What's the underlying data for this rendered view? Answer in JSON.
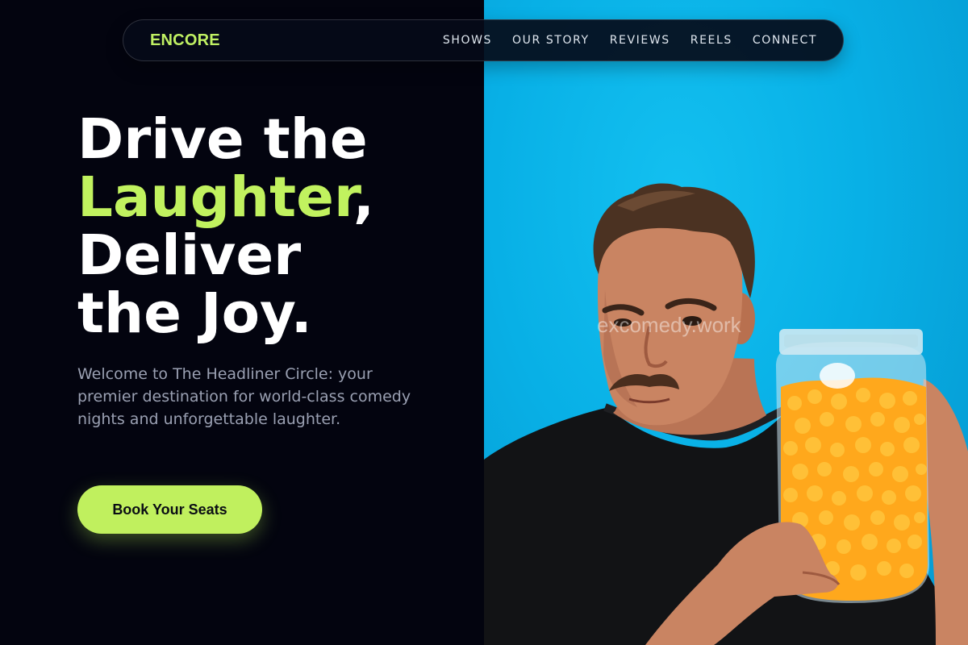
{
  "brand": {
    "name": "ENCORE",
    "accent_color": "#c0f063"
  },
  "nav": {
    "links": [
      {
        "label": "SHOWS"
      },
      {
        "label": "OUR STORY"
      },
      {
        "label": "REVIEWS"
      },
      {
        "label": "REELS"
      },
      {
        "label": "CONNECT"
      }
    ]
  },
  "hero": {
    "title_line1": "Drive the",
    "title_accent": "Laughter",
    "title_comma": ",",
    "title_line3": "Deliver",
    "title_line4": "the Joy.",
    "description": "Welcome to The Headliner Circle: your premier destination for world-class comedy nights and unforgettable laughter.",
    "cta_label": "Book Your Seats"
  },
  "photo": {
    "alt": "Comedian holding a jar of cheese puffs",
    "watermark": "excomedy.work",
    "background_color": "#08b0e6"
  },
  "colors": {
    "background": "#03040f",
    "accent": "#c1f25f",
    "text_muted": "#9aa0b2"
  }
}
